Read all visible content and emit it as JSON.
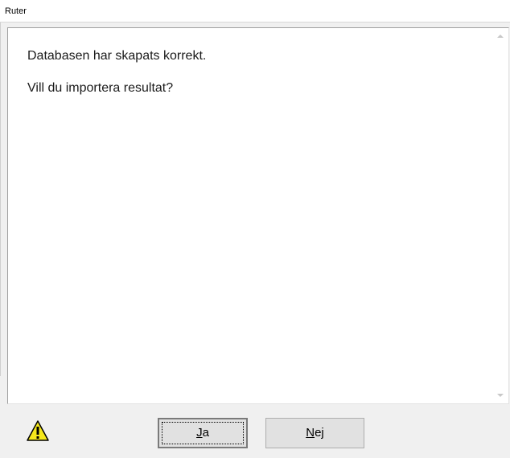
{
  "window": {
    "title": "Ruter"
  },
  "message": {
    "line1": "Databasen har skapats korrekt.",
    "line2": "Vill du importera resultat?"
  },
  "icons": {
    "status": "warning-icon",
    "scroll_up": "chevron-up-icon",
    "scroll_down": "chevron-down-icon"
  },
  "buttons": {
    "yes": {
      "accel": "J",
      "rest": "a"
    },
    "no": {
      "accel": "N",
      "rest": "ej"
    }
  },
  "colors": {
    "warning_fill": "#f5e81c",
    "warning_border": "#000000",
    "background": "#f0f0f0"
  }
}
